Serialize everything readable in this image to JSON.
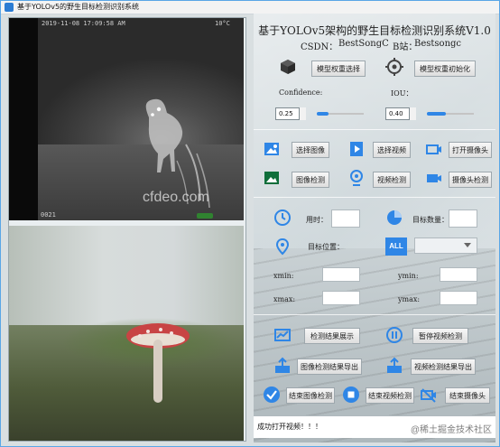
{
  "window": {
    "title": "基于YOLOv5的野生目标检测识别系统"
  },
  "left_panel": {
    "camera": {
      "timestamp": "2019-11-08 17:09:58 AM",
      "temp": "10°C",
      "corner_code": "0021",
      "watermark": "cfdeo.com"
    }
  },
  "header": {
    "title": "基于YOLOv5架构的野生目标检测识别系统V1.0",
    "csdn_label": "CSDN：",
    "csdn_value": "BestSongC",
    "bilibili_label": "B站：",
    "bilibili_value": "Bestsongc"
  },
  "model": {
    "select_weights": "模型权重选择",
    "init_weights": "模型权重初始化"
  },
  "params": {
    "confidence_label": "Confidence:",
    "confidence_value": "0.25",
    "confidence_level": 0.25,
    "iou_label": "IOU：",
    "iou_value": "0.40",
    "iou_level": 0.4
  },
  "actions": {
    "select_image": "选择图像",
    "select_video": "选择视频",
    "open_camera": "打开摄像头",
    "detect_image": "图像检测",
    "detect_video": "视频检测",
    "detect_camera": "摄像头检测"
  },
  "stats": {
    "time_label": "用时：",
    "count_label": "目标数量：",
    "position_label": "目标位置：",
    "all_label": "ALL",
    "xmin_label": "xmin:",
    "ymin_label": "ymin:",
    "xmax_label": "xmax:",
    "ymax_label": "ymax:"
  },
  "results": {
    "show_results": "检测结果展示",
    "pause_video": "暂停视频检测",
    "export_image_results": "图像检测结果导出",
    "export_video_results": "视频检测结果导出",
    "end_image_detection": "结束图像检测",
    "end_video_detection": "结束视频检测",
    "end_camera": "结束摄像头"
  },
  "status": {
    "message": "成功打开视频！！！",
    "watermark": "@稀土掘金技术社区"
  },
  "colors": {
    "accent_blue": "#2f86e6",
    "window_border": "#5aa6e6"
  }
}
